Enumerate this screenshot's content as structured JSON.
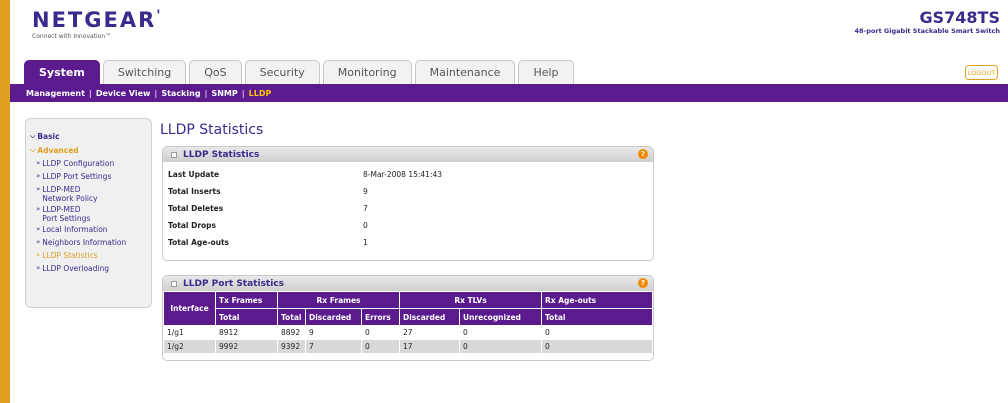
{
  "brand": {
    "logo": "NETGEAR",
    "tagline": "Connect with Innovation™"
  },
  "device": {
    "model": "GS748TS",
    "description": "48-port Gigabit Stackable Smart Switch"
  },
  "tabs": [
    {
      "label": "System",
      "active": true
    },
    {
      "label": "Switching",
      "active": false
    },
    {
      "label": "QoS",
      "active": false
    },
    {
      "label": "Security",
      "active": false
    },
    {
      "label": "Monitoring",
      "active": false
    },
    {
      "label": "Maintenance",
      "active": false
    },
    {
      "label": "Help",
      "active": false
    }
  ],
  "logout_label": "LOGOUT",
  "subnav": [
    {
      "label": "Management",
      "active": false
    },
    {
      "label": "Device View",
      "active": false
    },
    {
      "label": "Stacking",
      "active": false
    },
    {
      "label": "SNMP",
      "active": false
    },
    {
      "label": "LLDP",
      "active": true
    }
  ],
  "sidebar": {
    "basic_label": "Basic",
    "advanced_label": "Advanced",
    "items": [
      {
        "label": "LLDP Configuration"
      },
      {
        "label": "LLDP Port Settings"
      },
      {
        "label": "LLDP-MED",
        "label2": "Network Policy"
      },
      {
        "label": "LLDP-MED",
        "label2": "Port Settings"
      },
      {
        "label": "Local Information"
      },
      {
        "label": "Neighbors Information"
      },
      {
        "label": "LLDP Statistics"
      },
      {
        "label": "LLDP Overloading"
      }
    ]
  },
  "page_title": "LLDP Statistics",
  "stats_panel": {
    "title": "LLDP Statistics",
    "rows": [
      {
        "label": "Last Update",
        "value": "8-Mar-2008 15:41:43"
      },
      {
        "label": "Total Inserts",
        "value": "9"
      },
      {
        "label": "Total Deletes",
        "value": "7"
      },
      {
        "label": "Total Drops",
        "value": "0"
      },
      {
        "label": "Total Age-outs",
        "value": "1"
      }
    ]
  },
  "ports_panel": {
    "title": "LLDP Port Statistics",
    "group_headers": [
      "Interface",
      "Tx Frames",
      "Rx Frames",
      "Rx TLVs",
      "Rx Age-outs"
    ],
    "sub_headers": [
      "Total",
      "Total",
      "Discarded",
      "Errors",
      "Discarded",
      "Unrecognized",
      "Total"
    ],
    "rows": [
      [
        "1/g1",
        "8912",
        "8892",
        "9",
        "0",
        "27",
        "0",
        "0"
      ],
      [
        "1/g2",
        "9992",
        "9392",
        "7",
        "0",
        "17",
        "0",
        "0"
      ]
    ]
  },
  "colors": {
    "brand_purple": "#5b1b8f",
    "accent_orange": "#e0a020",
    "link_blue": "#3a2a8c",
    "help_orange": "#f08a00"
  }
}
